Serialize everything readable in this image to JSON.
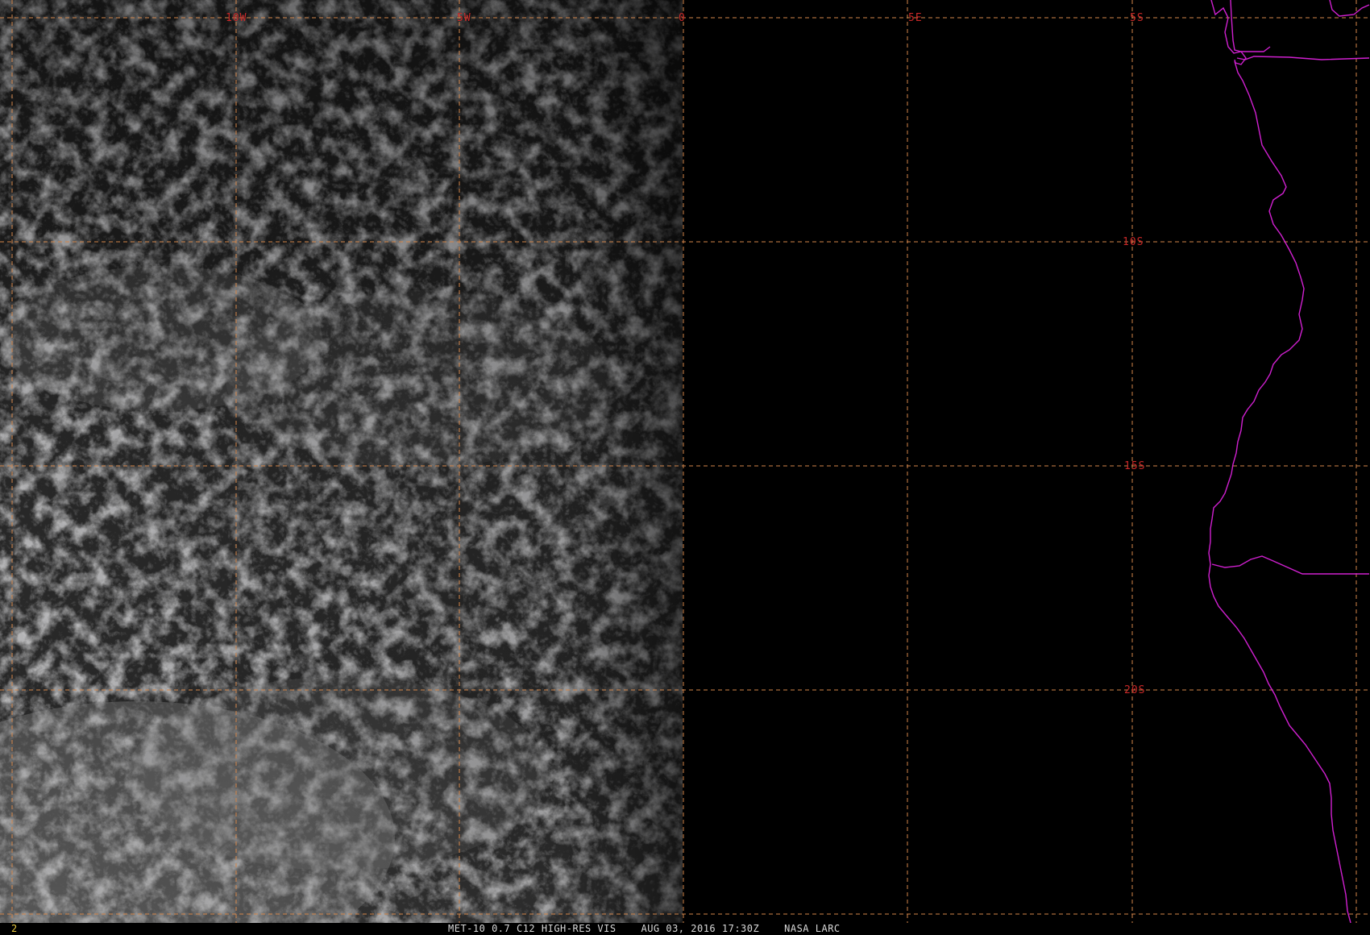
{
  "image": {
    "product_caption": "MET-10 0.7 C12 HIGH-RES VIS    AUG 03, 2016 17:30Z    NASA LARC",
    "frame_number": "2"
  },
  "grid": {
    "color": "#d4864a",
    "label_color": "#c82828",
    "longitude_labels": [
      "10W",
      "5W",
      "0",
      "5E"
    ],
    "latitude_labels": [
      "5S",
      "10S",
      "15S",
      "20S"
    ]
  },
  "map_outlines": {
    "color": "#d020d0",
    "feature": "west-african-coastline-and-borders"
  },
  "scene": {
    "cloud_tone": "#9a9a9a",
    "night_side": "#000000"
  }
}
